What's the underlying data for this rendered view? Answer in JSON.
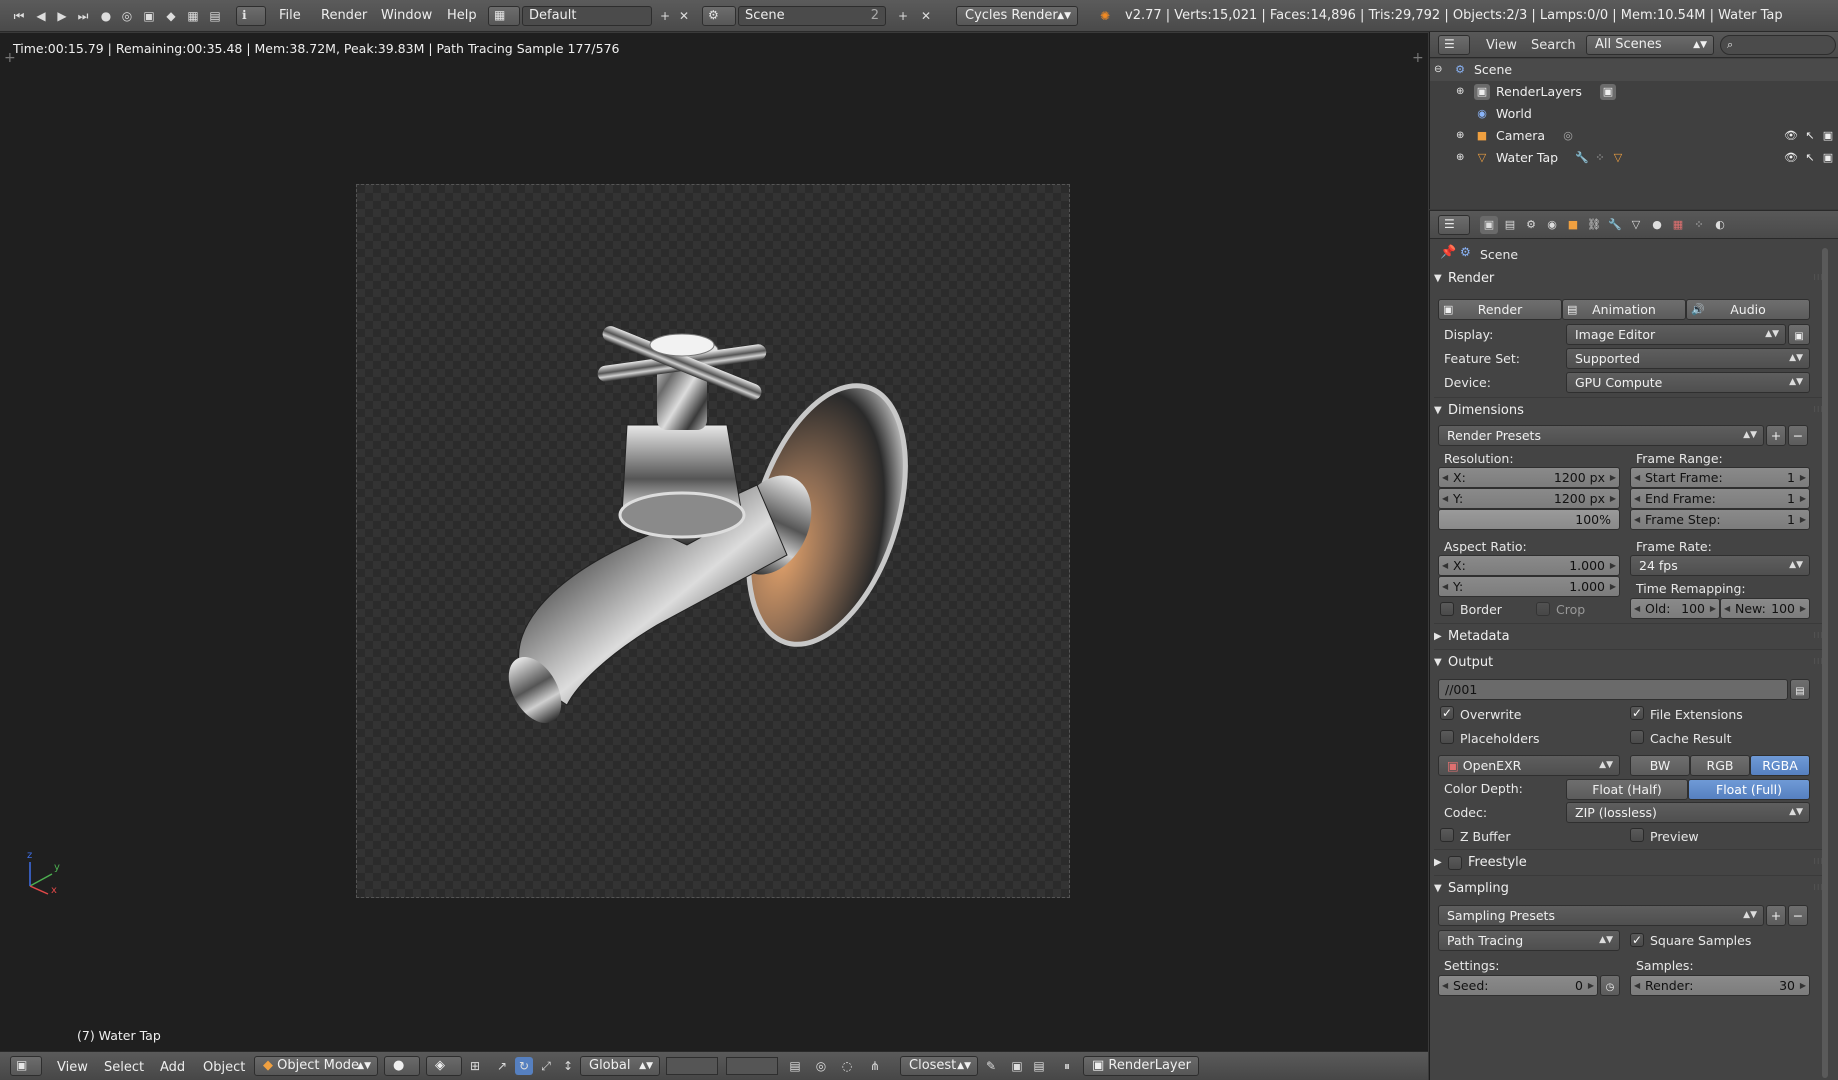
{
  "topbar": {
    "menus": [
      "File",
      "Render",
      "Window",
      "Help"
    ],
    "layout": "Default",
    "scene": "Scene",
    "scene_users": "2",
    "engine": "Cycles Render",
    "stats": "v2.77 | Verts:15,021 | Faces:14,896 | Tris:29,792 | Objects:2/3 | Lamps:0/0 | Mem:10.54M | Water Tap"
  },
  "viewport": {
    "info": "Time:00:15.79 | Remaining:00:35.48 | Mem:38.72M, Peak:39.83M | Path Tracing Sample 177/576",
    "object_label": "(7) Water Tap",
    "axis_x": "x",
    "axis_y": "y",
    "axis_z": "z"
  },
  "bottombar": {
    "menus": [
      "View",
      "Select",
      "Add",
      "Object"
    ],
    "mode": "Object Mode",
    "orientation": "Global",
    "snap": "Closest",
    "render_layer": "RenderLayer"
  },
  "outliner": {
    "view": "View",
    "search": "Search",
    "filter": "All Scenes",
    "rows": [
      {
        "label": "Scene"
      },
      {
        "label": "RenderLayers"
      },
      {
        "label": "World"
      },
      {
        "label": "Camera"
      },
      {
        "label": "Water Tap"
      }
    ]
  },
  "props": {
    "context": "Scene",
    "render_panel": {
      "title": "Render",
      "buttons": [
        "Render",
        "Animation",
        "Audio"
      ],
      "display_label": "Display:",
      "display_value": "Image Editor",
      "feature_label": "Feature Set:",
      "feature_value": "Supported",
      "device_label": "Device:",
      "device_value": "GPU Compute"
    },
    "dimensions": {
      "title": "Dimensions",
      "presets": "Render Presets",
      "resolution_label": "Resolution:",
      "res_x_label": "X:",
      "res_x": "1200 px",
      "res_y_label": "Y:",
      "res_y": "1200 px",
      "res_pct": "100%",
      "frame_range_label": "Frame Range:",
      "start_label": "Start Frame:",
      "start": "1",
      "end_label": "End Frame:",
      "end": "1",
      "step_label": "Frame Step:",
      "step": "1",
      "aspect_label": "Aspect Ratio:",
      "asp_x_label": "X:",
      "asp_x": "1.000",
      "asp_y_label": "Y:",
      "asp_y": "1.000",
      "frame_rate_label": "Frame Rate:",
      "fps": "24 fps",
      "time_remap_label": "Time Remapping:",
      "old_label": "Old:",
      "old": "100",
      "new_label": "New:",
      "new": "100",
      "border": "Border",
      "crop": "Crop"
    },
    "metadata": {
      "title": "Metadata"
    },
    "output": {
      "title": "Output",
      "path": "//001",
      "overwrite": "Overwrite",
      "file_ext": "File Extensions",
      "placeholders": "Placeholders",
      "cache": "Cache Result",
      "format": "OpenEXR",
      "bw": "BW",
      "rgb": "RGB",
      "rgba": "RGBA",
      "depth_label": "Color Depth:",
      "half": "Float (Half)",
      "full": "Float (Full)",
      "codec_label": "Codec:",
      "codec": "ZIP (lossless)",
      "zbuffer": "Z Buffer",
      "preview": "Preview"
    },
    "freestyle": {
      "title": "Freestyle"
    },
    "sampling": {
      "title": "Sampling",
      "presets": "Sampling Presets",
      "method": "Path Tracing",
      "square": "Square Samples",
      "settings_label": "Settings:",
      "samples_label": "Samples:",
      "seed_label": "Seed:",
      "seed": "0",
      "render_label": "Render:",
      "render": "30"
    }
  }
}
